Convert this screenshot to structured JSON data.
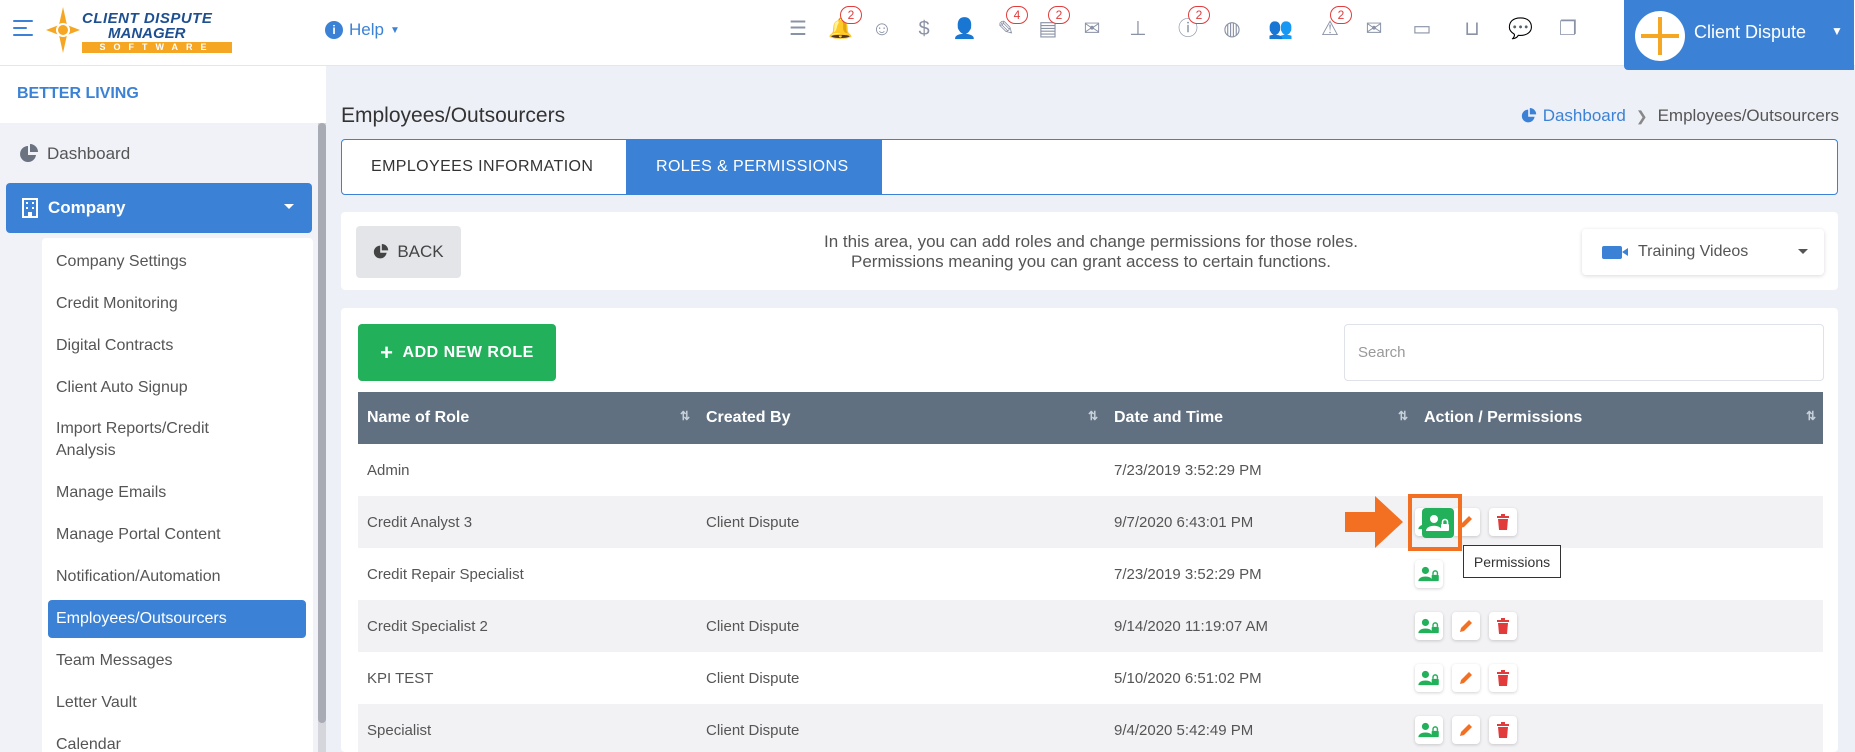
{
  "app": {
    "logo_line1": "CLIENT DISPUTE",
    "logo_line2": "MANAGER",
    "logo_line3": "SOFTWARE",
    "help_label": "Help",
    "user_name": "Client Dispute"
  },
  "topbar_icons": [
    {
      "icon": "checklist-icon",
      "badge": ""
    },
    {
      "icon": "bell-icon",
      "badge": "2"
    },
    {
      "icon": "support-agent-icon",
      "badge": ""
    },
    {
      "icon": "dollar-icon",
      "badge": ""
    },
    {
      "icon": "user-tie-icon",
      "badge": ""
    },
    {
      "icon": "pen-icon",
      "badge": "4"
    },
    {
      "icon": "document-icon",
      "badge": "2"
    },
    {
      "icon": "envelope-icon",
      "badge": ""
    },
    {
      "icon": "sitemap-icon",
      "badge": ""
    },
    {
      "icon": "info-icon",
      "badge": "2"
    },
    {
      "icon": "globe-icon",
      "badge": ""
    },
    {
      "icon": "users-icon",
      "badge": ""
    },
    {
      "icon": "warning-icon",
      "badge": "2"
    },
    {
      "icon": "mail-stack-icon",
      "badge": ""
    },
    {
      "icon": "money-icon",
      "badge": ""
    },
    {
      "icon": "inbox-icon",
      "badge": ""
    },
    {
      "icon": "chat-icon",
      "badge": ""
    },
    {
      "icon": "copy-icon",
      "badge": ""
    }
  ],
  "sidebar": {
    "org_name": "BETTER LIVING",
    "dashboard_label": "Dashboard",
    "company_label": "Company",
    "items": [
      "Company Settings",
      "Credit Monitoring",
      "Digital Contracts",
      "Client Auto Signup",
      "Import Reports/Credit Analysis",
      "Manage Emails",
      "Manage Portal Content",
      "Notification/Automation",
      "Employees/Outsourcers",
      "Team Messages",
      "Letter Vault",
      "Calendar"
    ],
    "active_item": "Employees/Outsourcers"
  },
  "page": {
    "title": "Employees/Outsourcers",
    "breadcrumb_home": "Dashboard",
    "breadcrumb_current": "Employees/Outsourcers",
    "tabs": [
      "EMPLOYEES INFORMATION",
      "ROLES & PERMISSIONS"
    ],
    "active_tab": "ROLES & PERMISSIONS",
    "back_label": "BACK",
    "info_line1": "In this area, you can add roles and change permissions for those roles.",
    "info_line2": "Permissions meaning you can grant access to certain functions.",
    "training_label": "Training Videos",
    "add_role_label": "ADD NEW ROLE",
    "search_placeholder": "Search",
    "tooltip": "Permissions"
  },
  "table": {
    "columns": [
      "Name of Role",
      "Created By",
      "Date and Time",
      "Action / Permissions"
    ],
    "rows": [
      {
        "name": "Admin",
        "created_by": "",
        "date": "7/23/2019 3:52:29 PM",
        "actions": []
      },
      {
        "name": "Credit Analyst 3",
        "created_by": "Client Dispute",
        "date": "9/7/2020 6:43:01 PM",
        "actions": [
          "permissions",
          "edit",
          "delete"
        ]
      },
      {
        "name": "Credit Repair Specialist",
        "created_by": "",
        "date": "7/23/2019 3:52:29 PM",
        "actions": [
          "permissions"
        ]
      },
      {
        "name": "Credit Specialist 2",
        "created_by": "Client Dispute",
        "date": "9/14/2020 11:19:07 AM",
        "actions": [
          "permissions",
          "edit",
          "delete"
        ]
      },
      {
        "name": "KPI TEST",
        "created_by": "Client Dispute",
        "date": "5/10/2020 6:51:02 PM",
        "actions": [
          "permissions",
          "edit",
          "delete"
        ]
      },
      {
        "name": "Specialist",
        "created_by": "Client Dispute",
        "date": "9/4/2020 5:42:49 PM",
        "actions": [
          "permissions",
          "edit",
          "delete"
        ]
      }
    ]
  },
  "colors": {
    "primary": "#3b82d6",
    "success": "#22b05a",
    "danger": "#e23b3b",
    "edit": "#f36f21",
    "table_header": "#607080",
    "highlight": "#f36f21"
  }
}
